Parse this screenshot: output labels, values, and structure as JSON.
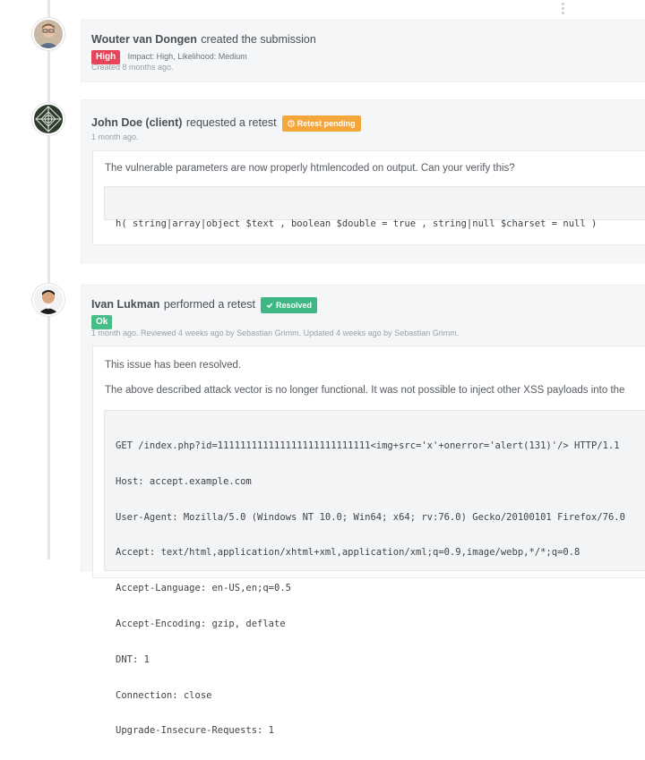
{
  "events": [
    {
      "actor": "Wouter van Dongen",
      "action": "created the submission",
      "severity_badge": "High",
      "impact_text": "Impact: High, Likelihood: Medium",
      "meta": "Created 8 months ago."
    },
    {
      "actor": "John Doe (client)",
      "action": "requested a retest",
      "status_badge": "Retest pending",
      "status_icon": "clock-icon",
      "meta": "1 month ago.",
      "comment": "The vulnerable parameters are now properly htmlencoded on output. Can your verify this?",
      "code": "h( string|array|object $text , boolean $double = true , string|null $charset = null )"
    },
    {
      "actor": "Ivan Lukman",
      "action": "performed a retest",
      "status_badge": "Resolved",
      "status_icon": "check-icon",
      "result_badge": "Ok",
      "meta": "1 month ago. Reviewed 4 weeks ago by Sebastian Grimm. Updated 4 weeks ago by Sebastian Grimm.",
      "paragraphs": [
        "This issue has been resolved.",
        "The above described attack vector is no longer functional. It was not possible to inject other XSS payloads into the"
      ],
      "code_lines": [
        "GET /index.php?id=111111111111111111111111111<img+src='x'+onerror='alert(131)'/> HTTP/1.1",
        "Host: accept.example.com",
        "User-Agent: Mozilla/5.0 (Windows NT 10.0; Win64; x64; rv:76.0) Gecko/20100101 Firefox/76.0",
        "Accept: text/html,application/xhtml+xml,application/xml;q=0.9,image/webp,*/*;q=0.8",
        "Accept-Language: en-US,en;q=0.5",
        "Accept-Encoding: gzip, deflate",
        "DNT: 1",
        "Connection: close",
        "Upgrade-Insecure-Requests: 1"
      ]
    }
  ],
  "colors": {
    "high": "#e8445a",
    "retest_pending": "#f5a73b",
    "resolved": "#3db885",
    "ok": "#47bd88"
  }
}
